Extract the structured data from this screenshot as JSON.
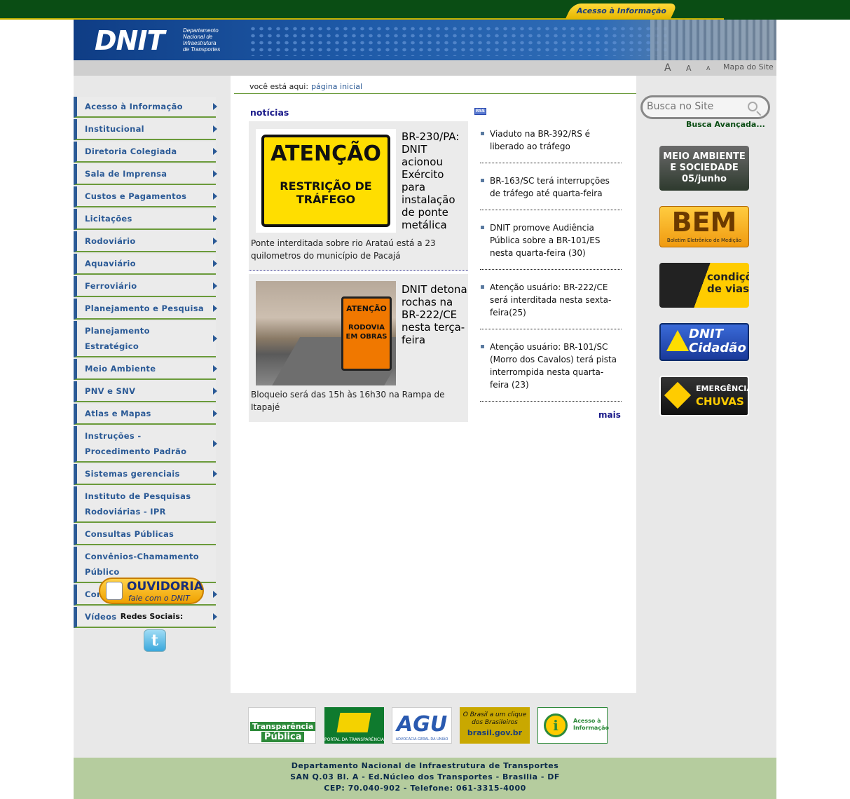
{
  "top_bar": {
    "acesso_tab": "Acesso à Informação"
  },
  "header": {
    "logo": "DNIT",
    "logo_subtitle": [
      "Departamento",
      "Nacional de",
      "Infraestrutura",
      "de Transportes"
    ]
  },
  "toolbar": {
    "font_large": "A",
    "font_medium": "A",
    "font_small": "A",
    "site_map": "Mapa do Site"
  },
  "breadcrumb": {
    "prefix": "você está aqui:",
    "current": "página inicial"
  },
  "left_nav": {
    "items": [
      {
        "label": "Acesso à Informação",
        "submenu": true
      },
      {
        "label": "Institucional",
        "submenu": true
      },
      {
        "label": "Diretoria Colegiada",
        "submenu": true
      },
      {
        "label": "Sala de Imprensa",
        "submenu": true
      },
      {
        "label": "Custos e Pagamentos",
        "submenu": true
      },
      {
        "label": "Licitações",
        "submenu": true
      },
      {
        "label": "Rodoviário",
        "submenu": true
      },
      {
        "label": "Aquaviário",
        "submenu": true
      },
      {
        "label": "Ferroviário",
        "submenu": true
      },
      {
        "label": "Planejamento e Pesquisa",
        "submenu": true
      },
      {
        "label": "Planejamento Estratégico",
        "submenu": true
      },
      {
        "label": "Meio Ambiente",
        "submenu": true
      },
      {
        "label": "PNV e SNV",
        "submenu": true
      },
      {
        "label": "Atlas e Mapas",
        "submenu": true
      },
      {
        "label": "Instruções - Procedimento Padrão",
        "submenu": true
      },
      {
        "label": "Sistemas gerenciais",
        "submenu": true
      },
      {
        "label": "Instituto de Pesquisas Rodoviárias - IPR",
        "submenu": false
      },
      {
        "label": "Consultas Públicas",
        "submenu": false
      },
      {
        "label": "Convênios-Chamamento Público",
        "submenu": false
      },
      {
        "label": "Concurso Público",
        "submenu": true
      },
      {
        "label": "Vídeos",
        "submenu": true
      }
    ],
    "ouvidoria": {
      "title": "OUVIDORIA",
      "subtitle": "fale com o DNIT"
    },
    "social_label": "Redes Sociais:"
  },
  "news": {
    "title": "notícias",
    "rss": "RSS",
    "featured": [
      {
        "headline": "BR-230/PA: DNIT acionou Exército para instalação de ponte metálica",
        "description": "Ponte interditada sobre rio Arataú está a 23 quilometros do município de Pacajá",
        "image_text": [
          "ATENÇÃO",
          "RESTRIÇÃO DE TRÁFEGO"
        ]
      },
      {
        "headline": "DNIT detona rochas na BR-222/CE nesta terça-feira",
        "description": "Bloqueio será das 15h às 16h30 na Rampa de Itapajé",
        "image_text": [
          "ATENÇÃO",
          "RODOVIA EM OBRAS"
        ]
      }
    ],
    "list": [
      "Viaduto na BR-392/RS é liberado ao tráfego",
      "BR-163/SC terá interrupções de tráfego até quarta-feira",
      "DNIT promove Audiência Pública sobre a BR-101/ES nesta quarta-feira (30)",
      "Atenção usuário: BR-222/CE será interditada nesta sexta-feira(25)",
      "Atenção usuário: BR-101/SC (Morro dos Cavalos) terá pista interrompida nesta quarta-feira (23)"
    ],
    "more": "mais"
  },
  "right_column": {
    "search_placeholder": "Busca no Site",
    "advanced_search": "Busca Avançada...",
    "banners": {
      "meio_ambiente": "MEIO AMBIENTE E SOCIEDADE 05/junho",
      "bem_big": "BEM",
      "bem_small": "Boletim Eletrônico de Medição",
      "condicoes": "condições de vias",
      "cidadao": "DNIT Cidadão",
      "emerg_1": "EMERGÊNCIAS",
      "emerg_2": "CHUVAS"
    }
  },
  "footer_logos": {
    "transparencia_1": "Transparência",
    "transparencia_2": "Pública",
    "portal": "PORTAL DA TRANSPARÊNCIA",
    "agu": "AGU",
    "agu_sub": "ADVOCACIA-GERAL DA UNIÃO",
    "brasil_1": "O Brasil a um clique dos Brasileiros",
    "brasil_2": "brasil.gov.br",
    "acesso_icon": "i",
    "acesso": "Acesso à Informação"
  },
  "footer": {
    "line1": "Departamento Nacional de Infraestrutura de Transportes",
    "line2": "SAN Q.03 Bl. A - Ed.Núcleo dos Transportes - Brasilia - DF",
    "line3": "CEP: 70.040-902 - Telefone: 061-3315-4000"
  }
}
